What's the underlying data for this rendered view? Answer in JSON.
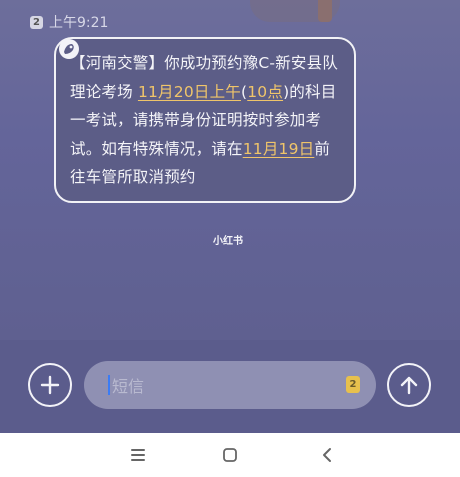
{
  "status": {
    "sim": "2",
    "time": "上午9:21"
  },
  "message": {
    "parts": [
      {
        "text": "【河南交警】你成功预约豫C-新安县队理论考场 ",
        "hl": false
      },
      {
        "text": "11月20日上午",
        "hl": true
      },
      {
        "text": "(",
        "hl": false
      },
      {
        "text": "10点",
        "hl": true
      },
      {
        "text": ")的科目一考试，请携带身份证明按时参加考试。如有特殊情况，请在",
        "hl": false
      },
      {
        "text": "11月19日",
        "hl": true
      },
      {
        "text": "前往车管所取消预约",
        "hl": false
      }
    ]
  },
  "watermark": "小红书",
  "composer": {
    "placeholder": "短信",
    "sim_tag": "2"
  },
  "icons": {
    "add": "plus-icon",
    "send": "arrow-up-icon",
    "menu": "menu-icon",
    "home": "home-square-icon",
    "back": "back-chevron-icon",
    "avatar": "sender-avatar-icon"
  },
  "colors": {
    "highlight": "#f0c56a",
    "background": "#6d6e9b",
    "cursor": "#3b7cf5"
  }
}
